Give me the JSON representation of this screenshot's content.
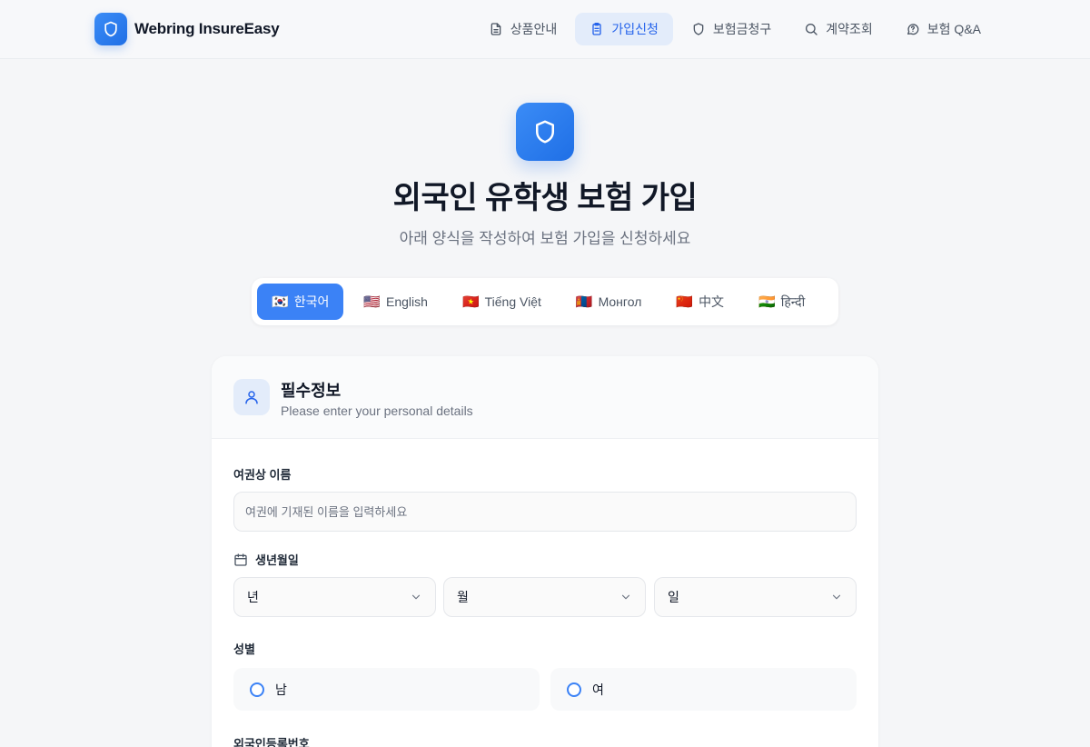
{
  "brand": {
    "name": "Webring InsureEasy"
  },
  "nav": [
    {
      "label": "상품안내",
      "icon": "document-icon"
    },
    {
      "label": "가입신청",
      "icon": "clipboard-icon",
      "active": true
    },
    {
      "label": "보험금청구",
      "icon": "shield-icon"
    },
    {
      "label": "계약조회",
      "icon": "search-icon"
    },
    {
      "label": "보험 Q&A",
      "icon": "chat-question-icon"
    }
  ],
  "hero": {
    "icon": "shield-icon",
    "title": "외국인 유학생 보험 가입",
    "subtitle": "아래 양식을 작성하여 보험 가입을 신청하세요"
  },
  "languages": [
    {
      "flag": "🇰🇷",
      "label": "한국어",
      "active": true
    },
    {
      "flag": "🇺🇸",
      "label": "English"
    },
    {
      "flag": "🇻🇳",
      "label": "Tiếng Việt"
    },
    {
      "flag": "🇲🇳",
      "label": "Монгол"
    },
    {
      "flag": "🇨🇳",
      "label": "中文"
    },
    {
      "flag": "🇮🇳",
      "label": "हिन्दी"
    }
  ],
  "form": {
    "section_icon": "user-icon",
    "section_title": "필수정보",
    "section_desc": "Please enter your personal details",
    "name_label": "여권상 이름",
    "name_placeholder": "여권에 기재된 이름을 입력하세요",
    "name_value": "",
    "birth_label": "생년월일",
    "birth_icon": "calendar-icon",
    "birth_year": "년",
    "birth_month": "월",
    "birth_day": "일",
    "gender_label": "성별",
    "gender_male": "남",
    "gender_female": "여",
    "arc_label": "외국인등록번호"
  },
  "colors": {
    "accent": "#3b82f6",
    "accent_dark": "#2563eb",
    "accent_soft": "#e3ecfa",
    "background": "#f5f6f8"
  }
}
